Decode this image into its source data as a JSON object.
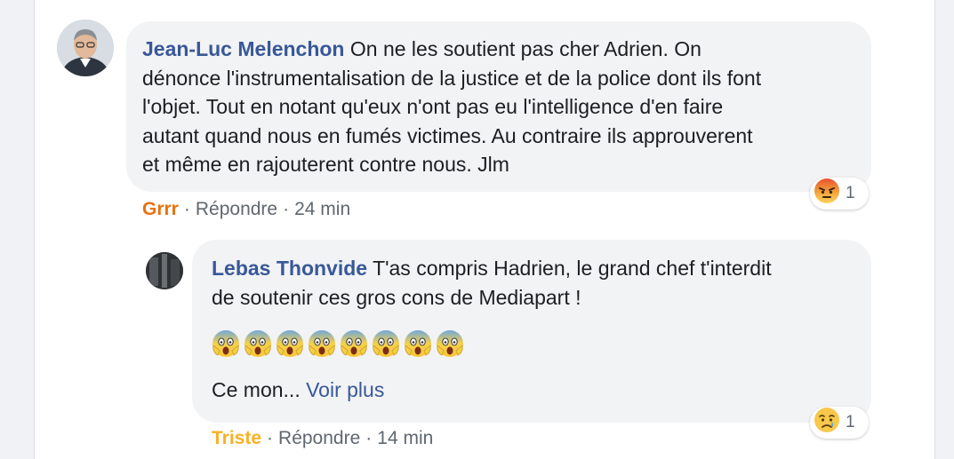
{
  "comment1": {
    "author": "Jean-Luc Melenchon",
    "text_lines": [
      " On ne les soutient pas cher Adrien. On",
      "dénonce l'instrumentalisation de la justice et de la police dont ils font",
      "l'objet. Tout en notant qu'eux n'ont pas eu l'intelligence d'en faire",
      "autant quand nous en fumés victimes. Au contraire ils approuverent",
      "et même en rajouterent contre nous. Jlm"
    ],
    "reaction_count": "1",
    "reaction_icon": "angry-emoji-icon",
    "action_reaction": "Grrr",
    "action_reply": "Répondre",
    "time": "24 min"
  },
  "comment2": {
    "author": "Lebas Thonvide",
    "text_lines": [
      " T'as compris Hadrien, le grand chef t'interdit",
      "de soutenir ces gros cons de Mediapart !"
    ],
    "emoji_count": 8,
    "emoji_icon": "screaming-face-emoji-icon",
    "truncated_text": "Ce mon...",
    "see_more": "Voir plus",
    "reaction_count": "1",
    "reaction_icon": "sad-emoji-icon",
    "action_reaction": "Triste",
    "action_reply": "Répondre",
    "time": "14 min"
  },
  "separator": "·",
  "colors": {
    "author": "#385898",
    "grrr": "#e9710f",
    "triste": "#f7b125",
    "bubble": "#f2f3f5",
    "meta": "#606770"
  }
}
